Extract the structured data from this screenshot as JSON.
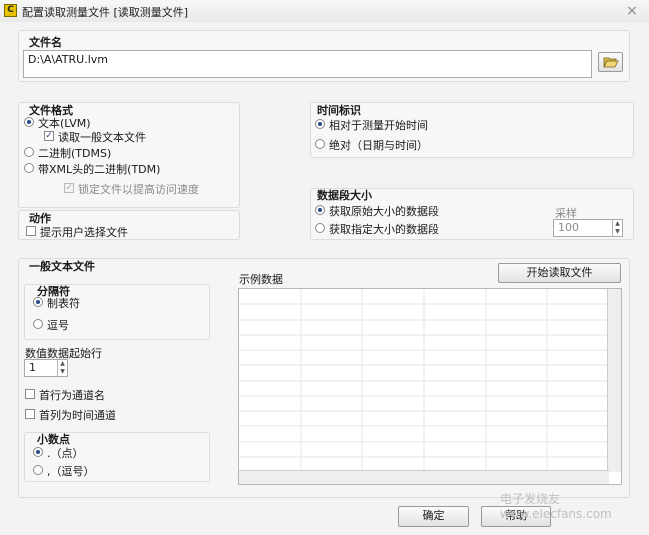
{
  "window": {
    "title": "配置读取测量文件 [读取测量文件]",
    "close_glyph": "×",
    "icon_glyph": "C"
  },
  "file_section": {
    "label": "文件名",
    "path_value": "D:\\A\\ATRU.lvm",
    "browse_icon": "folder-open-icon"
  },
  "file_format": {
    "label": "文件格式",
    "options": [
      {
        "label": "文本(LVM)",
        "selected": true
      },
      {
        "label": "二进制(TDMS)",
        "selected": false
      },
      {
        "label": "带XML头的二进制(TDM)",
        "selected": false
      }
    ],
    "read_generic_text": {
      "label": "读取一般文本文件",
      "checked": true
    },
    "lock_file": {
      "label": "锁定文件以提高访问速度",
      "checked": true,
      "enabled": false
    }
  },
  "action": {
    "label": "动作",
    "prompt_user": {
      "label": "提示用户选择文件",
      "checked": false
    }
  },
  "time_stamp": {
    "label": "时间标识",
    "options": [
      {
        "label": "相对于测量开始时间",
        "selected": true
      },
      {
        "label": "绝对（日期与时间）",
        "selected": false
      }
    ]
  },
  "segment_size": {
    "label": "数据段大小",
    "options": [
      {
        "label": "获取原始大小的数据段",
        "selected": true
      },
      {
        "label": "获取指定大小的数据段",
        "selected": false
      }
    ],
    "samples_label": "采样",
    "samples_value": "100"
  },
  "generic_text": {
    "label": "一般文本文件",
    "delimiter": {
      "label": "分隔符",
      "options": [
        {
          "label": "制表符",
          "selected": true
        },
        {
          "label": "逗号",
          "selected": false
        }
      ]
    },
    "start_row_label": "数值数据起始行",
    "start_row_value": "1",
    "first_row_channel": {
      "label": "首行为通道名",
      "checked": false
    },
    "first_col_time": {
      "label": "首列为时间通道",
      "checked": false
    },
    "decimal": {
      "label": "小数点",
      "options": [
        {
          "label": ".（点）",
          "selected": true
        },
        {
          "label": ",（逗号）",
          "selected": false
        }
      ]
    }
  },
  "sample_data": {
    "label": "示例数据",
    "start_button": "开始读取文件",
    "columns": 6,
    "rows": 12
  },
  "footer": {
    "ok": "确定",
    "help": "帮助"
  },
  "watermark": "电子发烧友 www.elecfans.com"
}
